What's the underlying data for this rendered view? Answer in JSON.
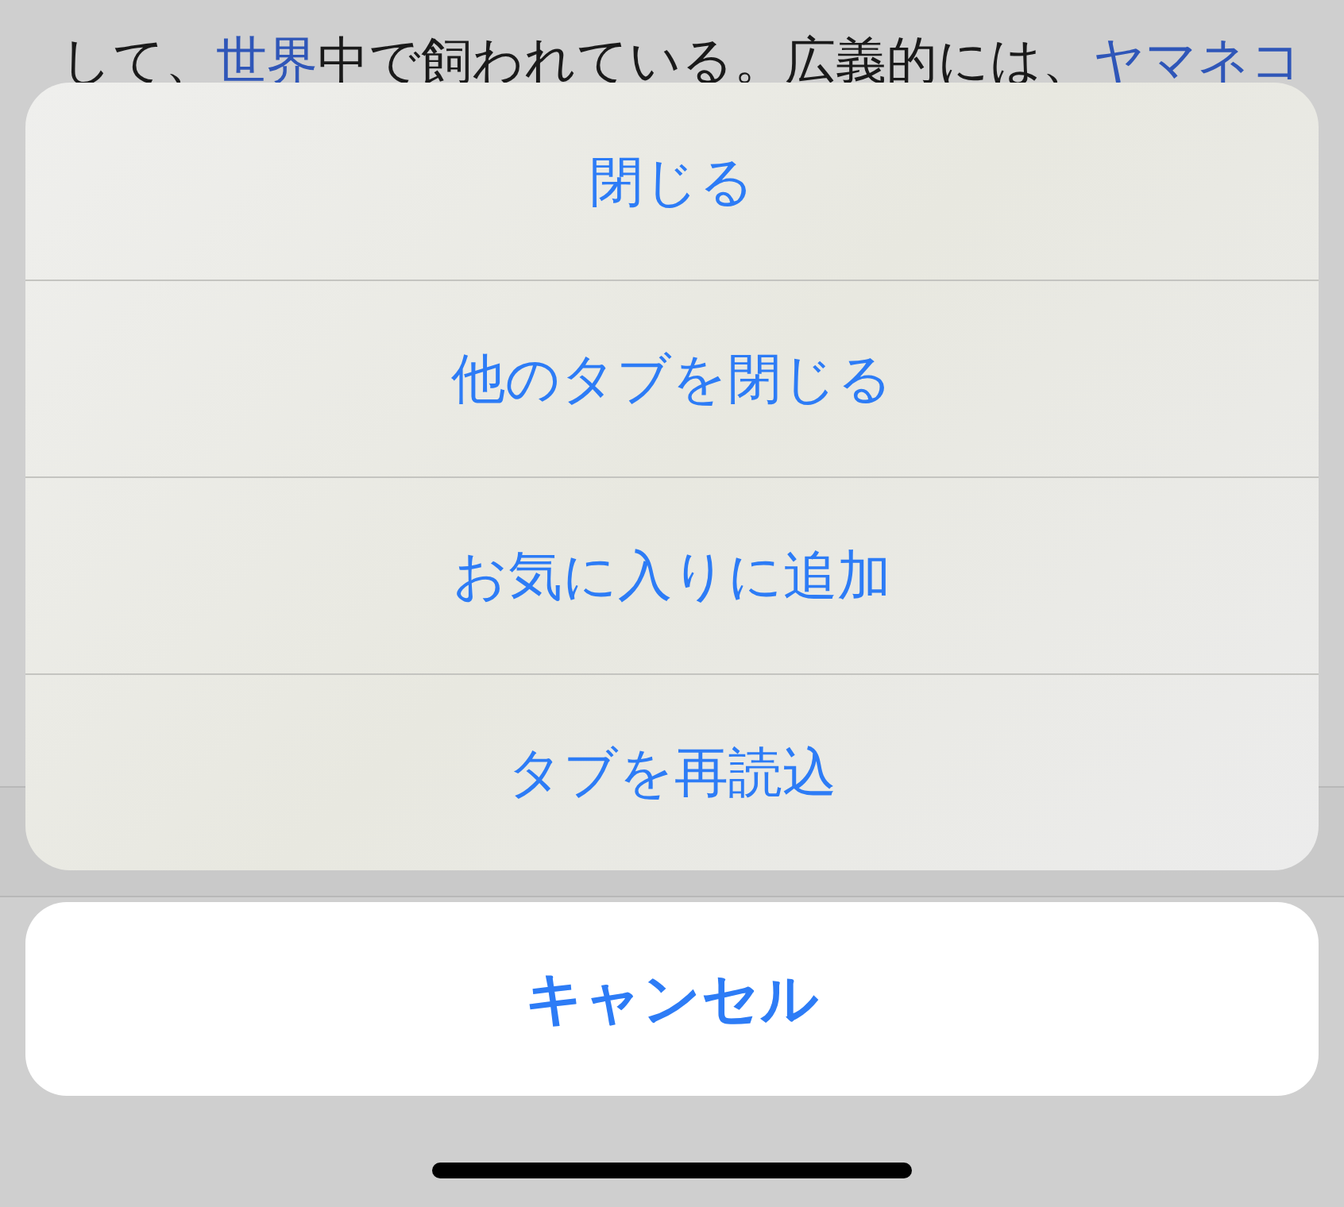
{
  "article": {
    "segments": [
      {
        "text": "して、",
        "link": false
      },
      {
        "text": "世界",
        "link": true
      },
      {
        "text": "中で飼われている。広義的には、",
        "link": false
      },
      {
        "text": "ヤマネコ",
        "link": true
      }
    ]
  },
  "action_sheet": {
    "actions": [
      {
        "label": "閉じる"
      },
      {
        "label": "他のタブを閉じる"
      },
      {
        "label": "お気に入りに追加"
      },
      {
        "label": "タブを再読込"
      }
    ],
    "cancel": {
      "label": "キャンセル"
    }
  }
}
